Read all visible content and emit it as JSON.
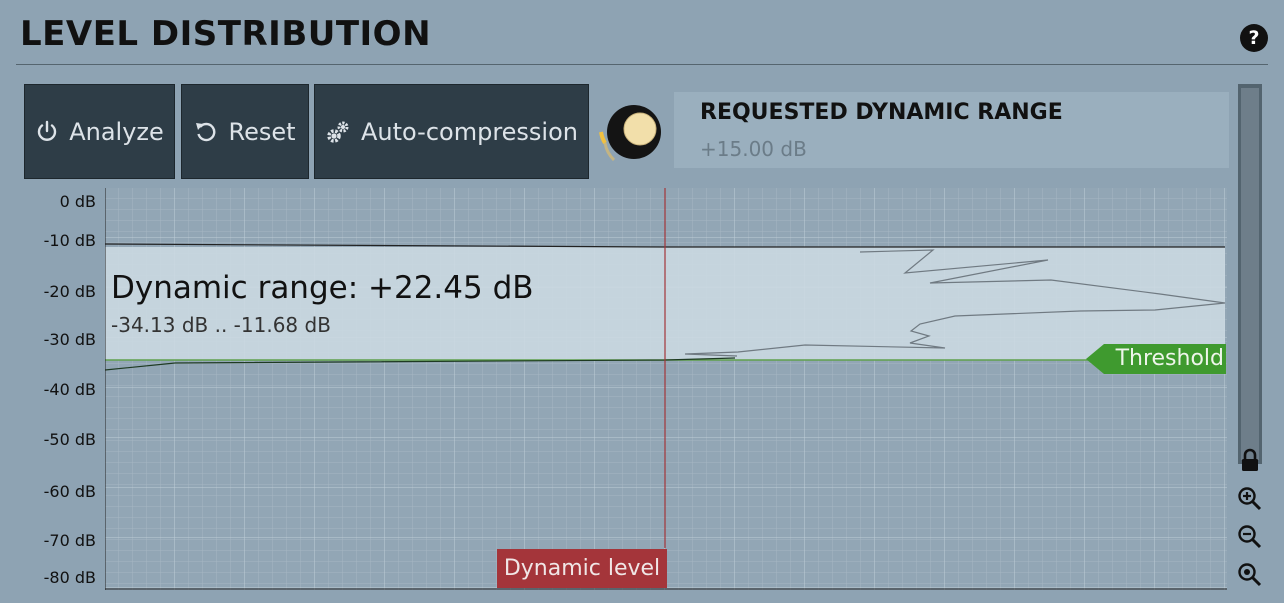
{
  "header": {
    "title": "LEVEL DISTRIBUTION",
    "help_icon": "?"
  },
  "toolbar": {
    "analyze_label": "Analyze",
    "reset_label": "Reset",
    "auto_label": "Auto-compression"
  },
  "parameter": {
    "title": "REQUESTED DYNAMIC RANGE",
    "value": "+15.00 dB"
  },
  "graph": {
    "y_axis_labels": [
      "0 dB",
      "-10 dB",
      "-20 dB",
      "-30 dB",
      "-40 dB",
      "-50 dB",
      "-60 dB",
      "-70 dB",
      "-80 dB"
    ],
    "dynamic_range_text": "Dynamic range: +22.45 dB",
    "range_text": "-34.13 dB .. -11.68 dB",
    "dynamic_level_label": "Dynamic level",
    "threshold_label": "Threshold"
  },
  "colors": {
    "background": "#8ea3b3",
    "button": "#2e3d47",
    "range_band": "#ccdbe3",
    "dynamic_level": "#a4353a",
    "threshold": "#3f9a2f"
  },
  "icons": [
    "power-icon",
    "undo-icon",
    "gears-icon",
    "lock-icon",
    "zoom-in-icon",
    "zoom-out-icon",
    "zoom-fit-icon",
    "help-icon"
  ]
}
